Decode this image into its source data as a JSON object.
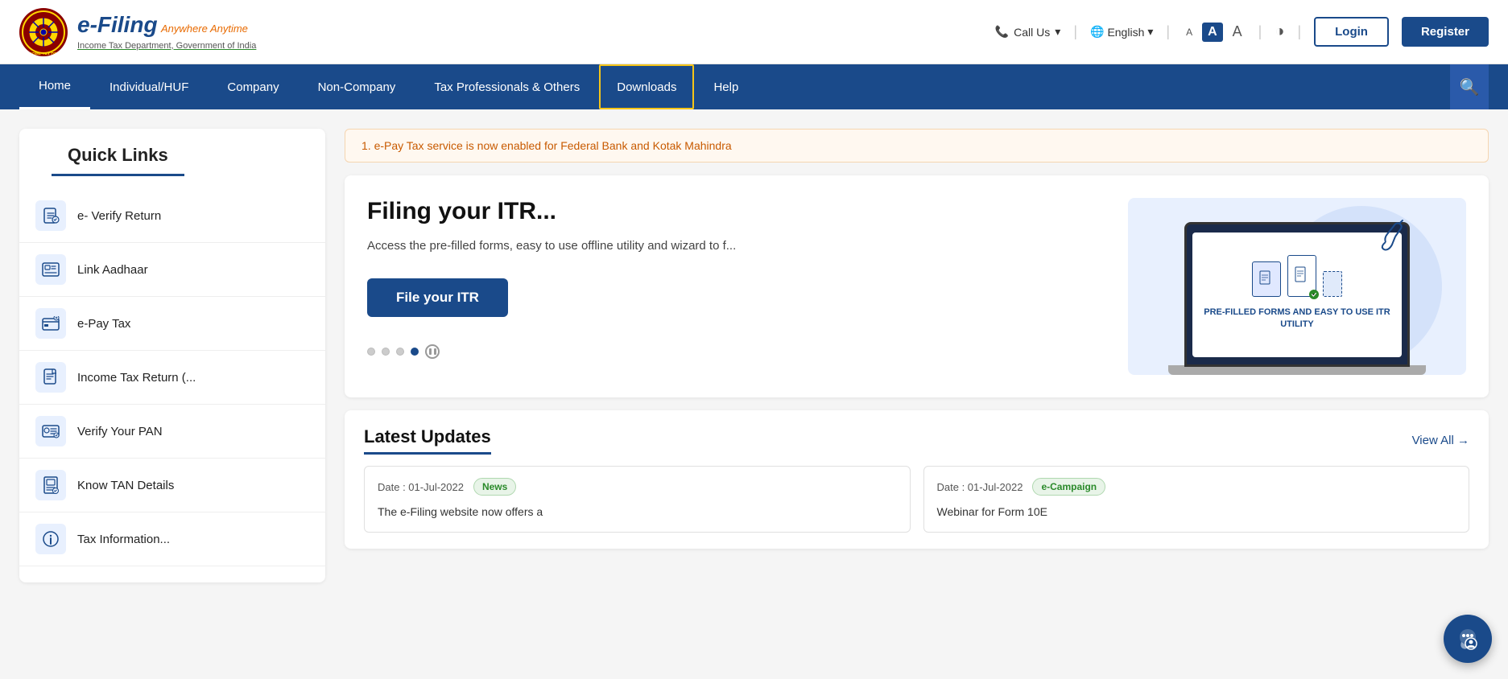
{
  "header": {
    "logo_efiling": "e-Filing",
    "logo_tagline": "Anywhere Anytime",
    "logo_subtitle": "Income Tax Department, Government of India",
    "call_us": "Call Us",
    "language": "English",
    "font_small": "A",
    "font_medium": "A",
    "font_large": "A",
    "btn_login": "Login",
    "btn_register": "Register"
  },
  "navbar": {
    "items": [
      {
        "label": "Home",
        "active": true,
        "highlighted": false
      },
      {
        "label": "Individual/HUF",
        "active": false,
        "highlighted": false
      },
      {
        "label": "Company",
        "active": false,
        "highlighted": false
      },
      {
        "label": "Non-Company",
        "active": false,
        "highlighted": false
      },
      {
        "label": "Tax Professionals & Others",
        "active": false,
        "highlighted": false
      },
      {
        "label": "Downloads",
        "active": false,
        "highlighted": true
      },
      {
        "label": "Help",
        "active": false,
        "highlighted": false
      }
    ]
  },
  "quick_links": {
    "title": "Quick Links",
    "items": [
      {
        "label": "e- Verify Return",
        "icon": "✉"
      },
      {
        "label": "Link Aadhaar",
        "icon": "💳"
      },
      {
        "label": "e-Pay Tax",
        "icon": "💰"
      },
      {
        "label": "Income Tax Return (...",
        "icon": "📄"
      },
      {
        "label": "Verify Your PAN",
        "icon": "🪪"
      },
      {
        "label": "Know TAN Details",
        "icon": "🏢"
      },
      {
        "label": "Tax Information...",
        "icon": "ℹ"
      }
    ]
  },
  "alert": {
    "text": "1. e-Pay Tax service is now enabled for Federal Bank and Kotak Mahindra"
  },
  "hero": {
    "title": "Filing your ITR...",
    "description": "Access the pre-filled forms, easy to use offline utility and wizard to f...",
    "btn_label": "File your ITR",
    "screen_label": "PRE-FILLED\nFORMS AND\nEASY TO USE\nITR UTILITY"
  },
  "latest_updates": {
    "title": "Latest Updates",
    "view_all": "View All →",
    "cards": [
      {
        "date": "Date : 01-Jul-2022",
        "badge": "News",
        "badge_type": "news",
        "text": "The e-Filing website now offers a"
      },
      {
        "date": "Date : 01-Jul-2022",
        "badge": "e-Campaign",
        "badge_type": "ecampaign",
        "text": "Webinar for Form 10E"
      }
    ]
  },
  "colors": {
    "primary": "#1a4a8a",
    "accent_orange": "#e86a00",
    "highlight_yellow": "#f5c518"
  }
}
